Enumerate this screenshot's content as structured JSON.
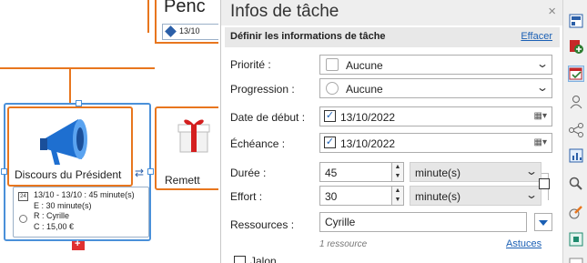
{
  "canvas": {
    "top_node_title": "Penc",
    "top_node_date": "13/10",
    "main_node": {
      "label": "Discours du Président",
      "calendar_day": "24",
      "details_line1": "13/10 - 13/10 : 45 minute(s)",
      "details_line2": "E : 30 minute(s)",
      "details_line3": "R : Cyrille",
      "details_line4": "C : 15,00 €"
    },
    "second_node": {
      "label": "Remett"
    }
  },
  "pane": {
    "title": "Infos de tâche",
    "close_label": "×",
    "section_title": "Définir les informations de tâche",
    "clear_link": "Effacer",
    "priority": {
      "label": "Priorité :",
      "value": "Aucune"
    },
    "progress": {
      "label": "Progression :",
      "value": "Aucune"
    },
    "start_date": {
      "label": "Date de début :",
      "value": "13/10/2022",
      "checked": true
    },
    "due_date": {
      "label": "Échéance :",
      "value": "13/10/2022",
      "checked": true
    },
    "duration": {
      "label": "Durée :",
      "value": "45",
      "unit": "minute(s)"
    },
    "effort": {
      "label": "Effort :",
      "value": "30",
      "unit": "minute(s)"
    },
    "resources": {
      "label": "Ressources :",
      "value": "Cyrille",
      "count": "1 ressource",
      "tips_link": "Astuces"
    },
    "milestone": {
      "label": "Jalon"
    }
  },
  "toolbar": {
    "icons": [
      "format-icon",
      "add-icon",
      "task-icon",
      "person-icon",
      "share-icon",
      "chart-icon",
      "search-icon",
      "pen-icon",
      "fit-icon",
      "extra-icon"
    ]
  },
  "colors": {
    "accent": "#e8761e",
    "selection": "#4a90d9",
    "link": "#1a5fb4"
  }
}
